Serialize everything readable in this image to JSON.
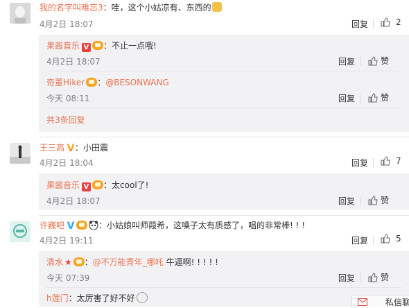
{
  "comments": [
    {
      "user": "我的名字叫难忘3",
      "text": "哇，这个小姑凉有、东西的",
      "time": "4月2日 18:07",
      "reply_label": "回复",
      "likes": "2",
      "sub_replies": [
        {
          "user": "果酱音乐",
          "text": "不止一点哦!",
          "time": "4月2日 18:07",
          "reply_label": "回复",
          "like_label": "赞"
        },
        {
          "user": "奇董Hiker",
          "mention": "@BESONWANG",
          "time": "今天 08:11",
          "reply_label": "回复",
          "like_label": "赞"
        }
      ],
      "more_replies": "共3条回复"
    },
    {
      "user": "王三高",
      "text": "小田震",
      "time": "4月2日 18:04",
      "reply_label": "回复",
      "likes": "7",
      "sub_replies": [
        {
          "user": "果酱音乐",
          "text": "太cool了!",
          "time": "4月2日 18:07",
          "reply_label": "回复",
          "like_label": "赞"
        }
      ]
    },
    {
      "user": "许巍吧",
      "text": "小姑娘叫师葭希，这嗓子太有质感了，唱的非常棒! ! !",
      "time": "4月2日 19:11",
      "reply_label": "回复",
      "likes": "5",
      "sub_replies": [
        {
          "user": "清水",
          "mention": "@不万能青年_哪吒",
          "text": "牛逼啊! ! ! ! !",
          "time": "今天 07:39",
          "reply_label": "回复",
          "like_label": "赞"
        },
        {
          "user": "h莲门",
          "text": "太厉害了好不好"
        }
      ]
    }
  ],
  "dm_label": "私信聊",
  "colors": {
    "username": "#eb7350",
    "reply_bg": "#f2f2f5",
    "time": "#808080"
  }
}
